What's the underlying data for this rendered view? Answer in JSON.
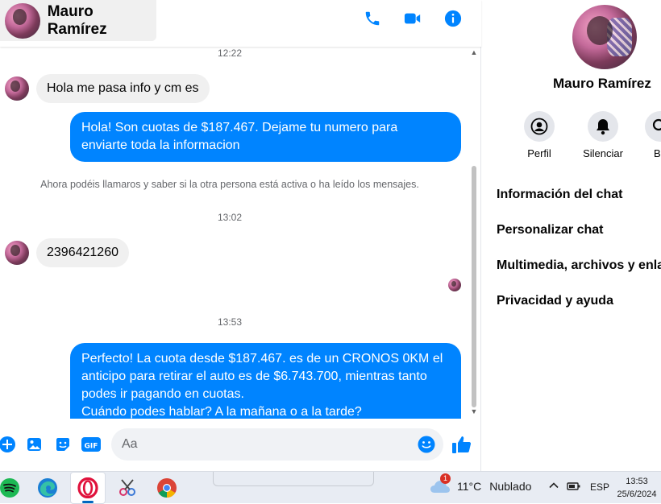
{
  "contact": {
    "name": "Mauro Ramírez"
  },
  "messages": {
    "ts1": "12:22",
    "in1": "Hola me pasa info y cm es",
    "out1_line1": "Hola! Son cuotas de $187.467. Dejame tu numero para",
    "out1_line2": "enviarte toda la informacion",
    "system": "Ahora podéis llamaros y saber si la otra persona está activa o ha leído los mensajes.",
    "ts2": "13:02",
    "in2": "2396421260",
    "ts3": "13:53",
    "out2_line1": "Perfecto! La cuota desde $187.467. es de un CRONOS 0KM el",
    "out2_line2": "anticipo para retirar el auto es de $6.743.700, mientras tanto",
    "out2_line3": "podes ir pagando en cuotas.",
    "out2_line4": "Cuándo podes hablar? A la mañana o a la tarde?"
  },
  "composer": {
    "placeholder": "Aa"
  },
  "info": {
    "name": "Mauro Ramírez",
    "actions": {
      "profile": "Perfil",
      "mute": "Silenciar",
      "search": "Bu"
    },
    "menu": {
      "chat_info": "Información del chat",
      "customize": "Personalizar chat",
      "media": "Multimedia, archivos y enla",
      "privacy": "Privacidad y ayuda"
    }
  },
  "taskbar": {
    "weather_temp": "11°C",
    "weather_desc": "Nublado",
    "weather_badge": "1",
    "lang": "ESP",
    "time": "13:53",
    "date": "25/6/2024"
  },
  "colors": {
    "accent": "#0084ff",
    "bubble_in": "#f0f0f0",
    "taskbar": "#e8ecf3"
  }
}
